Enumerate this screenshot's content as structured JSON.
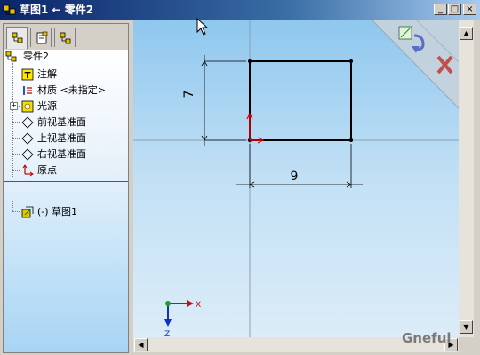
{
  "window": {
    "title": "草图1 ← 零件2",
    "minimize_label": "_",
    "maximize_label": "□",
    "close_label": "×"
  },
  "panel_tabs": [
    {
      "icon": "feature-manager-tree-icon",
      "active": true
    },
    {
      "icon": "property-manager-icon",
      "active": false
    },
    {
      "icon": "configuration-manager-icon",
      "active": false
    }
  ],
  "tree": {
    "root": "零件2",
    "items": [
      {
        "label": "注解",
        "icon": "annotations-icon"
      },
      {
        "label": "材质 <未指定>",
        "icon": "material-icon"
      },
      {
        "label": "光源",
        "icon": "lights-icon",
        "expander": "+"
      },
      {
        "label": "前视基准面",
        "icon": "plane-icon"
      },
      {
        "label": "上视基准面",
        "icon": "plane-icon"
      },
      {
        "label": "右视基准面",
        "icon": "plane-icon"
      },
      {
        "label": "原点",
        "icon": "origin-icon"
      },
      {
        "label": "(-) 草图1",
        "icon": "sketch-icon"
      }
    ]
  },
  "sketch": {
    "dim_vertical": "7",
    "dim_horizontal": "9"
  },
  "triad": {
    "x_label": "X",
    "z_label": "Z"
  },
  "watermark": "Gneful",
  "colors": {
    "confirm_accent": "#5a6fc4",
    "cancel_accent": "#c0504d",
    "canvas_top": "#8fc7ee"
  }
}
